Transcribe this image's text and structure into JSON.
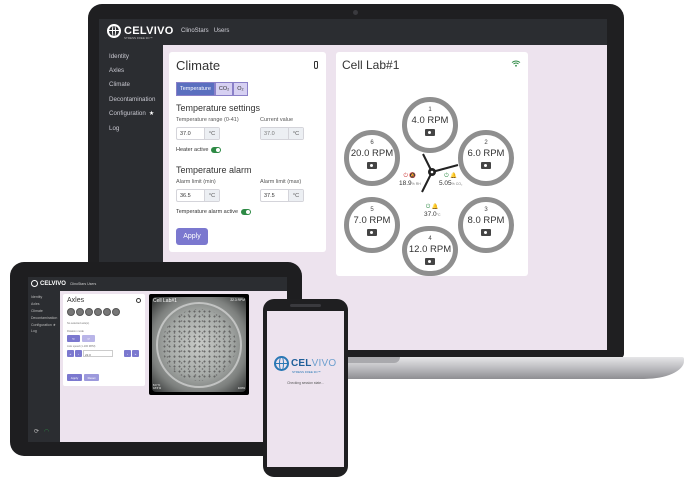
{
  "laptop": {
    "logo": {
      "word": "CELVIVO",
      "tagline": "STRESS FREE 3D™"
    },
    "topnav": [
      "ClinoStars",
      "Users"
    ],
    "sidebar": {
      "items": [
        {
          "label": "Identity"
        },
        {
          "label": "Axles"
        },
        {
          "label": "Climate"
        },
        {
          "label": "Decontamination"
        },
        {
          "label": "Configuration"
        },
        {
          "label": "Log"
        }
      ]
    },
    "climate": {
      "title": "Climate",
      "tabs": [
        "Temperature",
        "CO₂",
        "O₂"
      ],
      "settings_title": "Temperature settings",
      "range_label": "Temperature range (0-41)",
      "range_value": "37.0",
      "current_label": "Current value",
      "current_value": "37.0",
      "unit": "°C",
      "heater_label": "Heater active",
      "alarm_title": "Temperature alarm",
      "alarm_min_label": "Alarm limit (min)",
      "alarm_min_value": "36.5",
      "alarm_max_label": "Alarm limit (max)",
      "alarm_max_value": "37.5",
      "alarm_active_label": "Temperature alarm active",
      "apply_label": "Apply"
    },
    "cell_lab": {
      "title": "Cell Lab#1",
      "wells": [
        {
          "num": "1",
          "rpm": "4.0 RPM"
        },
        {
          "num": "2",
          "rpm": "6.0 RPM"
        },
        {
          "num": "3",
          "rpm": "8.0 RPM"
        },
        {
          "num": "4",
          "rpm": "12.0 RPM"
        },
        {
          "num": "5",
          "rpm": "7.0 RPM"
        },
        {
          "num": "6",
          "rpm": "20.0 RPM"
        }
      ],
      "humidity": {
        "value": "18.9",
        "unit": "% RH"
      },
      "co2": {
        "value": "5.05",
        "unit": "% CO₂"
      },
      "temperature": {
        "value": "37.0",
        "unit": "°C"
      }
    }
  },
  "tablet": {
    "logo": "CELVIVO",
    "topnav": "ClinoStars   Users",
    "sidebar": [
      "Identity",
      "Axles",
      "Climate",
      "Decontamination",
      "Configuration ★",
      "Log"
    ],
    "axles_title": "Axles",
    "no_selection": "No selected axle(s)",
    "rotation_label": "Rotation mode",
    "speed_label": "Axle speed (1-100 RPM)",
    "speed_value": "22.0",
    "apply_label": "Apply",
    "reset_label": "Reset",
    "camera": {
      "title": "Cell Lab#1",
      "rpm": "22.3 RPM",
      "info_line1": "8.0 °C",
      "info_line2": "18.5 %",
      "count": "100%"
    }
  },
  "phone": {
    "logo_cel": "CEL",
    "logo_vivo": "VIVO",
    "tagline": "STRESS FREE 3D™",
    "message": "Checking session state..."
  }
}
